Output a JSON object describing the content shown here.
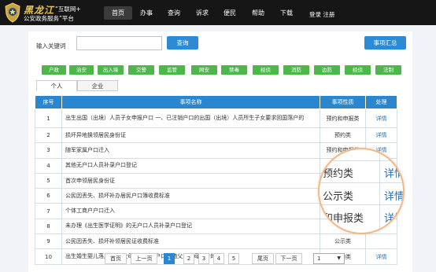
{
  "header": {
    "brand_name": "黑龙江",
    "brand_tag": "“互联网+",
    "brand_sub": "公安政务服务”平台",
    "nav": [
      "首页",
      "办事",
      "查询",
      "诉求",
      "便民",
      "帮助",
      "下载"
    ],
    "login": "登录 注册"
  },
  "search": {
    "label": "输入关键词",
    "value": "",
    "button": "查询",
    "summary_button": "事项汇总"
  },
  "categories": [
    "户政",
    "治安",
    "出入境",
    "交警",
    "监管",
    "网安",
    "禁毒",
    "经侦",
    "消防",
    "边防",
    "经侦",
    "法制"
  ],
  "tabs": [
    "个人",
    "企业"
  ],
  "table": {
    "headers": [
      "序号",
      "事项名称",
      "事项性质",
      "处理"
    ],
    "rows": [
      {
        "no": "1",
        "name": "出生出国（出境）人员子女申报户口 一、已注销户口的出国（出境）人员所生子女要求回国落户的",
        "type": "预约和申报类",
        "action": "详情"
      },
      {
        "no": "2",
        "name": "损坏异地换领居民身份证",
        "type": "预约类",
        "action": "详情"
      },
      {
        "no": "3",
        "name": "随军家属户口迁入",
        "type": "预约和申报类",
        "action": "详情"
      },
      {
        "no": "4",
        "name": "其他无户口人员补录户口登记",
        "type": "预约类",
        "action": "详情"
      },
      {
        "no": "5",
        "name": "首次申领居民身份证",
        "type": "",
        "action": ""
      },
      {
        "no": "6",
        "name": "公民因丢失、损坏补办居民户口簿收费标准",
        "type": "",
        "action": ""
      },
      {
        "no": "7",
        "name": "个体工商户户口迁入",
        "type": "",
        "action": ""
      },
      {
        "no": "8",
        "name": "未办理《出生医学证明》的无户口人员补录户口登记",
        "type": "",
        "action": ""
      },
      {
        "no": "9",
        "name": "公民因丢失、损坏补领居民证收费标准",
        "type": "公示类",
        "action": ""
      },
      {
        "no": "10",
        "name": "出生婚生婴儿落户 二、父母不在同一户口簿随父或随母落户的",
        "type": "预约类",
        "action": "详情"
      }
    ]
  },
  "magnifier": {
    "rows": [
      {
        "type": "预约类",
        "action": "详情"
      },
      {
        "type": "公示类",
        "action": "详情"
      },
      {
        "type": "和申报类",
        "action": "详情"
      }
    ]
  },
  "pager": {
    "first": "首页",
    "prev": "上一页",
    "pages": [
      "1",
      "2",
      "3",
      "4",
      "5"
    ],
    "last": "尾页",
    "next": "下一页",
    "select_value": "1"
  }
}
